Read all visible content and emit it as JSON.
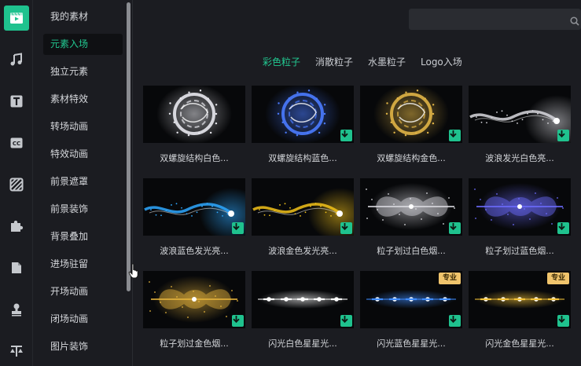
{
  "rail": {
    "items": [
      {
        "icon": "media-icon",
        "active": true
      },
      {
        "icon": "music-icon"
      },
      {
        "icon": "text-icon"
      },
      {
        "icon": "subtitle-icon"
      },
      {
        "icon": "filter-icon"
      },
      {
        "icon": "puzzle-icon"
      },
      {
        "icon": "folder-icon"
      },
      {
        "icon": "stamp-icon"
      },
      {
        "icon": "split-icon"
      }
    ]
  },
  "categories": {
    "items": [
      "我的素材",
      "元素入场",
      "独立元素",
      "素材特效",
      "转场动画",
      "特效动画",
      "前景遮罩",
      "前景装饰",
      "背景叠加",
      "进场驻留",
      "开场动画",
      "闭场动画",
      "图片装饰"
    ],
    "active": "元素入场"
  },
  "search": {
    "placeholder": ""
  },
  "subtabs": {
    "items": [
      "彩色粒子",
      "消散粒子",
      "水墨粒子",
      "Logo入场"
    ],
    "active": "彩色粒子"
  },
  "cards": [
    {
      "title": "双螺旋结构白色...",
      "tint": "#e8e8ee",
      "shape": "ring",
      "download": false
    },
    {
      "title": "双螺旋结构蓝色...",
      "tint": "#4a7bff",
      "shape": "ring",
      "download": true
    },
    {
      "title": "双螺旋结构金色...",
      "tint": "#e0b446",
      "shape": "ring",
      "download": true
    },
    {
      "title": "波浪发光白色亮...",
      "tint": "#d8d8de",
      "shape": "wave",
      "download": true
    },
    {
      "title": "波浪蓝色发光亮...",
      "tint": "#2ea8ff",
      "shape": "wave",
      "download": true
    },
    {
      "title": "波浪金色发光亮...",
      "tint": "#f2c21a",
      "shape": "wave",
      "download": true
    },
    {
      "title": "粒子划过白色烟...",
      "tint": "#dcdce2",
      "shape": "burst",
      "download": true
    },
    {
      "title": "粒子划过蓝色烟...",
      "tint": "#6d6cff",
      "shape": "burst",
      "download": true
    },
    {
      "title": "粒子划过金色烟...",
      "tint": "#e6b43c",
      "shape": "burst",
      "download": true
    },
    {
      "title": "闪光白色星星光...",
      "tint": "#ffffff",
      "shape": "sparkle",
      "download": true
    },
    {
      "title": "闪光蓝色星星光...",
      "tint": "#3f8cff",
      "shape": "sparkle",
      "download": true,
      "pro": "专业"
    },
    {
      "title": "闪光金色星星光...",
      "tint": "#f3c238",
      "shape": "sparkle",
      "download": true,
      "pro": "专业"
    }
  ],
  "colors": {
    "accent": "#1fc28e",
    "accent_text": "#22c891",
    "background": "#1b1c21",
    "pro_badge": "#f0c46c"
  }
}
